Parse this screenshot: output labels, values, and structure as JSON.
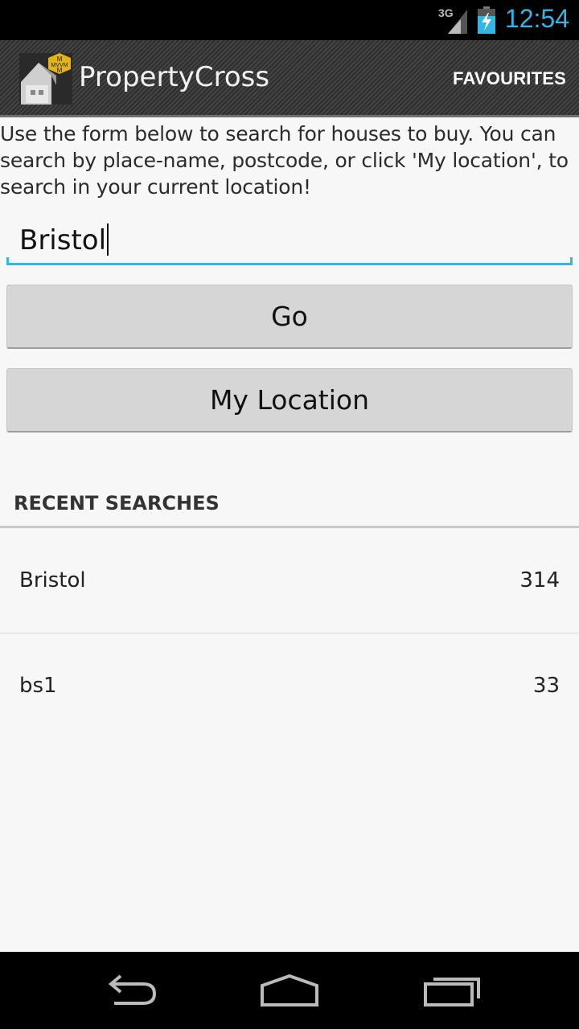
{
  "status_bar": {
    "network": "3G",
    "time": "12:54",
    "icons": [
      "signal-icon",
      "battery-charging-icon"
    ]
  },
  "action_bar": {
    "title": "PropertyCross",
    "favourites_label": "FAVOURITES",
    "logo_icon": "house-logo-icon"
  },
  "intro": {
    "text": "Use the form below to search for houses to buy. You can search by place-name, postcode, or click 'My location', to search in your current location!"
  },
  "search": {
    "value": "Bristol"
  },
  "buttons": {
    "go": "Go",
    "my_location": "My Location"
  },
  "recent": {
    "header": "RECENT SEARCHES",
    "items": [
      {
        "name": "Bristol",
        "count": "314"
      },
      {
        "name": "bs1",
        "count": "33"
      }
    ]
  },
  "nav_bar": {
    "icons": [
      "back-icon",
      "home-icon",
      "recent-apps-icon"
    ]
  },
  "colors": {
    "accent": "#33b5e5",
    "background": "#f7f7f7",
    "button": "#d6d6d6"
  }
}
